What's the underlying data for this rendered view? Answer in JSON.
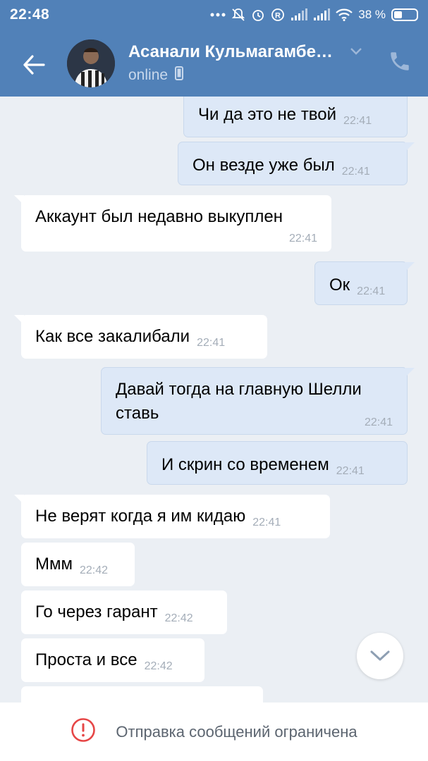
{
  "status_bar": {
    "time": "22:48",
    "battery": "38 %",
    "battery_level": 0.38,
    "icons": [
      "more-dots-icon",
      "mute-icon",
      "alarm-icon",
      "registered-icon",
      "signal-icon",
      "signal-icon",
      "wifi-icon",
      "battery-icon"
    ]
  },
  "header": {
    "name": "Асанали Кульмагамбе…",
    "status": "online",
    "colors": {
      "bar": "#5181b8",
      "status_text": "#c8d8ec"
    }
  },
  "messages": [
    {
      "dir": "out",
      "text": "Чи да это не твой",
      "time": "22:41"
    },
    {
      "dir": "out",
      "text": "Он везде уже был",
      "time": "22:41"
    },
    {
      "dir": "in",
      "text": "Аккаунт был недавно выкуплен",
      "time": "22:41"
    },
    {
      "dir": "out",
      "text": "Ок",
      "time": "22:41"
    },
    {
      "dir": "in",
      "text": "Как все закалибали",
      "time": "22:41"
    },
    {
      "dir": "out",
      "text": "Давай тогда на главную Шелли ставь",
      "time": "22:41"
    },
    {
      "dir": "out",
      "text": "И скрин со временем",
      "time": "22:41"
    },
    {
      "dir": "in",
      "text": "Не верят когда я им кидаю",
      "time": "22:41"
    },
    {
      "dir": "in",
      "text": "Ммм",
      "time": "22:42"
    },
    {
      "dir": "in",
      "text": "Го через гарант",
      "time": "22:42"
    },
    {
      "dir": "in",
      "text": "Проста и все",
      "time": "22:42"
    }
  ],
  "bottom_bar": {
    "notice": "Отправка сообщений ограничена",
    "icon": "error-circle-icon",
    "icon_color": "#e64646"
  }
}
